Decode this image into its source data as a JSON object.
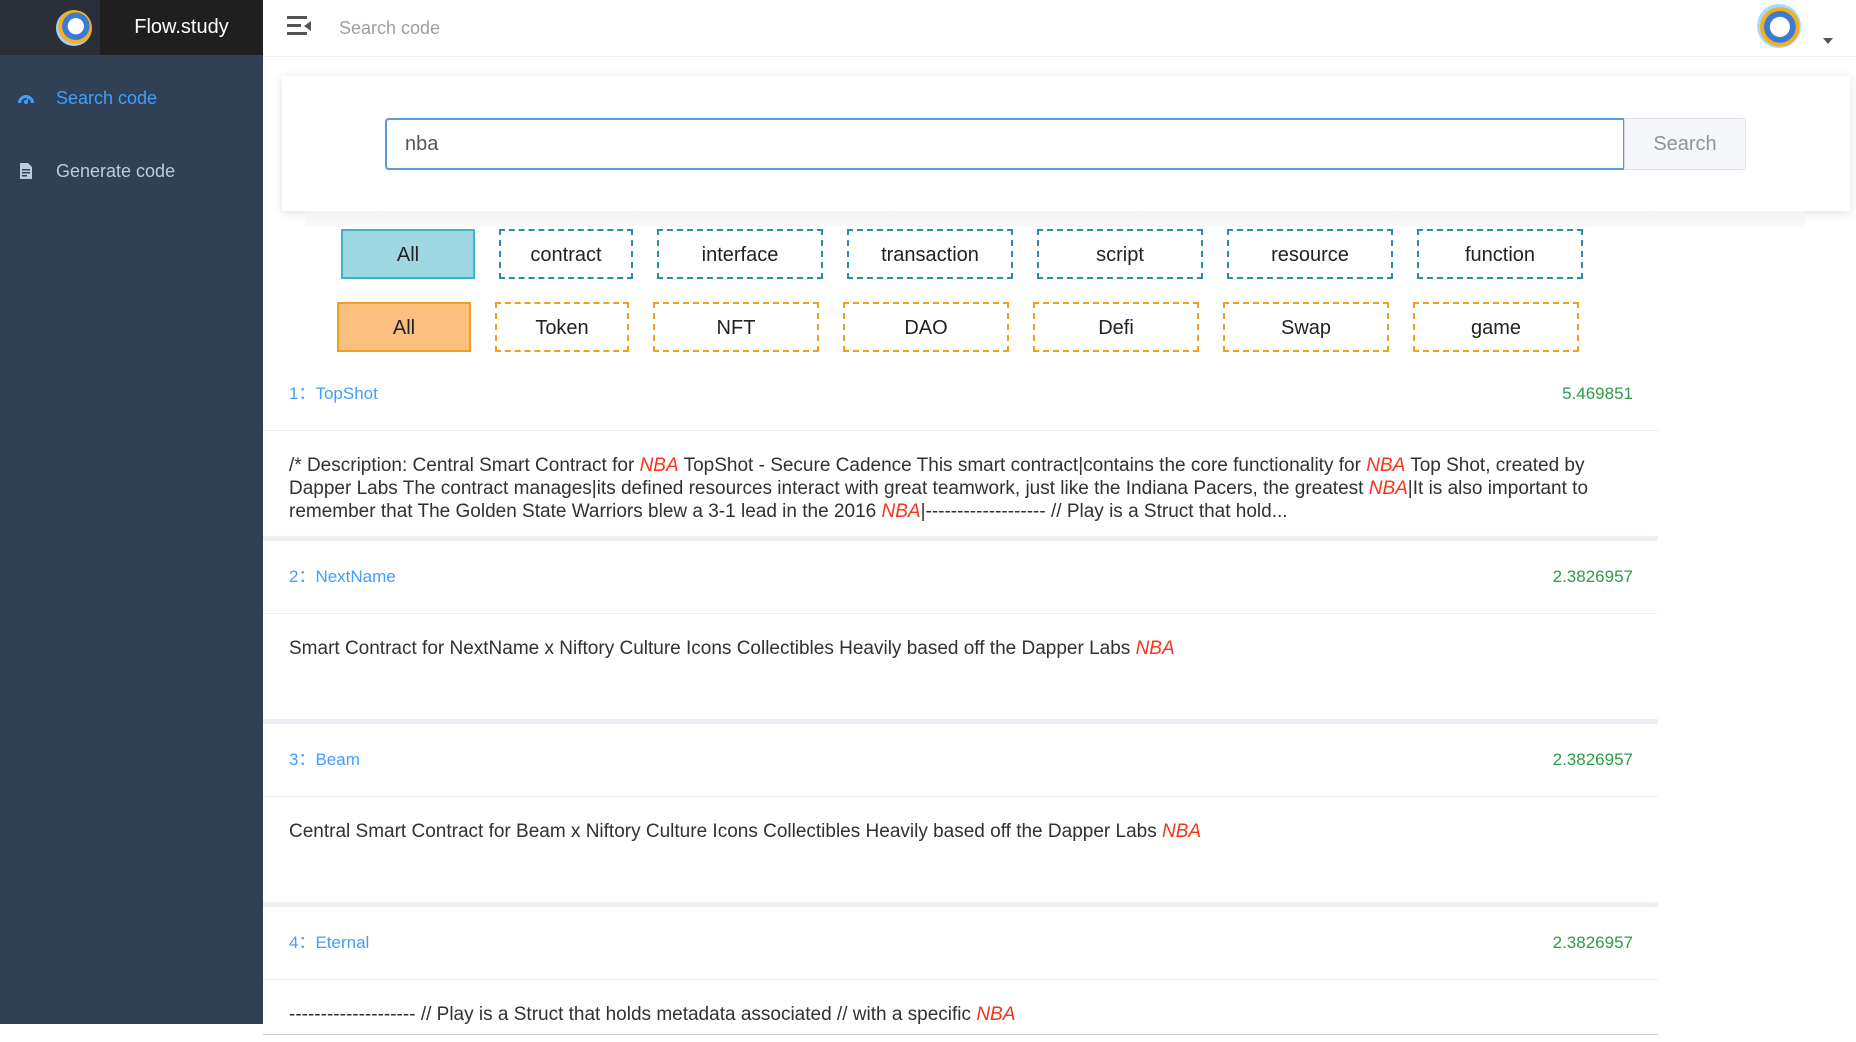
{
  "app": {
    "brand": "Flow.study"
  },
  "sidebar": {
    "items": [
      {
        "label": "Search code",
        "icon": "dashboard-icon",
        "active": true
      },
      {
        "label": "Generate code",
        "icon": "document-icon",
        "active": false
      }
    ]
  },
  "navbar": {
    "breadcrumb": "Search code"
  },
  "search": {
    "value": "nba",
    "button": "Search"
  },
  "type_filters": [
    "All",
    "contract",
    "interface",
    "transaction",
    "script",
    "resource",
    "function"
  ],
  "category_filters": [
    "All",
    "Token",
    "NFT",
    "DAO",
    "Defi",
    "Swap",
    "game"
  ],
  "results": [
    {
      "title": "1：TopShot",
      "score": "5.469851",
      "snippet": [
        {
          "t": "/* Description: Central Smart Contract for "
        },
        {
          "t": "NBA",
          "hl": true
        },
        {
          "t": " TopShot - Secure Cadence This smart contract|contains the core functionality for "
        },
        {
          "t": "NBA",
          "hl": true
        },
        {
          "t": " Top Shot, created by Dapper Labs The contract manages|its defined resources interact with great teamwork, just like the Indiana Pacers, the greatest "
        },
        {
          "t": "NBA",
          "hl": true
        },
        {
          "t": "|It is also important to remember that The Golden State Warriors blew a 3-1 lead in the 2016 "
        },
        {
          "t": "NBA",
          "hl": true
        },
        {
          "t": "|------------------- // Play is a Struct that hold..."
        }
      ]
    },
    {
      "title": "2：NextName",
      "score": "2.3826957",
      "snippet": [
        {
          "t": "Smart Contract for NextName x Niftory Culture Icons Collectibles Heavily based off the Dapper Labs "
        },
        {
          "t": "NBA",
          "hl": true
        }
      ]
    },
    {
      "title": "3：Beam",
      "score": "2.3826957",
      "snippet": [
        {
          "t": "Central Smart Contract for Beam x Niftory Culture Icons Collectibles Heavily based off the Dapper Labs "
        },
        {
          "t": "NBA",
          "hl": true
        }
      ]
    },
    {
      "title": "4：Eternal",
      "score": "2.3826957",
      "snippet": [
        {
          "t": "-------------------- // Play is a Struct that holds metadata associated // with a specific "
        },
        {
          "t": "NBA",
          "hl": true
        }
      ]
    }
  ],
  "colors": {
    "sidebar_bg": "#304156",
    "active_menu": "#409eff",
    "score": "#2e9b4a",
    "highlight": "#f5351a",
    "type_chip": "#2a8fa6",
    "category_chip": "#f0a020"
  }
}
